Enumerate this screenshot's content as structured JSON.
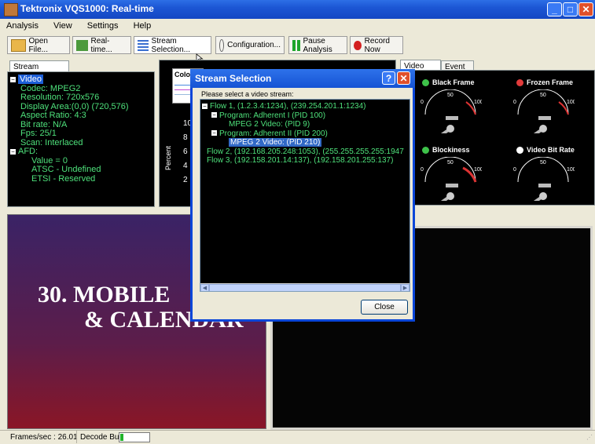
{
  "window": {
    "title": "Tektronix VQS1000: Real-time"
  },
  "menu": [
    "Analysis",
    "View",
    "Settings",
    "Help"
  ],
  "toolbar": {
    "open_file": "Open File...",
    "realtime": "Real-time...",
    "stream_selection": "Stream Selection...",
    "configuration": "Configuration...",
    "pause": "Pause Analysis",
    "record": "Record Now"
  },
  "stream_info": {
    "tab": "Stream Information",
    "root": "Video",
    "items": [
      "Codec: MPEG2",
      "Resolution: 720x576",
      "Display Area:(0,0) (720,576)",
      "Aspect Ratio: 4:3",
      "Bit rate: N/A",
      "Fps: 25/1",
      "Scan: Interlaced"
    ],
    "afd": "AFD:",
    "afd_items": [
      "Value = 0",
      "ATSC - Undefined",
      "ETSI - Reserved"
    ]
  },
  "color_panel": {
    "label": "Colo",
    "ticks": [
      "10",
      "8",
      "6",
      "4",
      "2"
    ],
    "ylabel": "Percent"
  },
  "video_tests": {
    "tabs": [
      "Video Tests",
      "Event Log"
    ],
    "gauges": [
      {
        "label": "Black Frame",
        "color": "#3ec24a",
        "mid": "50",
        "max": "100",
        "min": "0"
      },
      {
        "label": "Frozen Frame",
        "color": "#e23b3b",
        "mid": "50",
        "max": "100",
        "min": "0"
      },
      {
        "label": "Blockiness",
        "color": "#3ec24a",
        "mid": "50",
        "max": "100",
        "min": "0"
      },
      {
        "label": "Video Bit Rate",
        "color": "#ffffff",
        "mid": "50",
        "max": "100",
        "min": "0"
      }
    ]
  },
  "video_left": {
    "line1": "30. MOBILE",
    "line2": "& CALENDAR"
  },
  "status": {
    "fps": "Frames/sec : 26.01",
    "decode": "Decode Buffer"
  },
  "dialog": {
    "title": "Stream Selection",
    "prompt": "Please select a video stream:",
    "tree": {
      "flow1": "Flow 1, (1.2.3.4:1234), (239.254.201.1:1234)",
      "prog1": "Program: Adherent I (PID 100)",
      "video1": "MPEG 2 Video: (PID 9)",
      "prog2": "Program: Adherent II (PID 200)",
      "video2": "MPEG 2 Video: (PID 210)",
      "flow2": "Flow 2, (192.168.205.248:1053), (255.255.255.255:1947",
      "flow3": "Flow 3, (192.158.201.14:137), (192.158.201.255:137)"
    },
    "close": "Close"
  }
}
